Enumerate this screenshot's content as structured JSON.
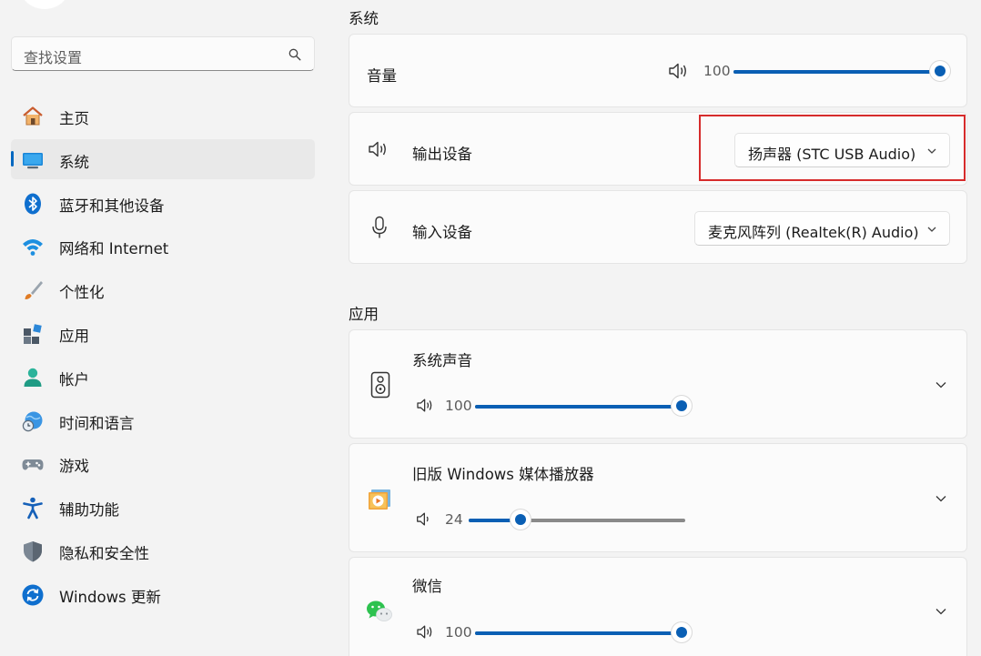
{
  "search": {
    "placeholder": "查找设置"
  },
  "nav": [
    {
      "name": "nav-item-home",
      "icon": "home-icon",
      "label": "主页",
      "active": false
    },
    {
      "name": "nav-item-system",
      "icon": "monitor-icon",
      "label": "系统",
      "active": true
    },
    {
      "name": "nav-item-bluetooth",
      "icon": "bluetooth-icon",
      "label": "蓝牙和其他设备",
      "active": false
    },
    {
      "name": "nav-item-network",
      "icon": "wifi-icon",
      "label": "网络和 Internet",
      "active": false
    },
    {
      "name": "nav-item-personalization",
      "icon": "brush-icon",
      "label": "个性化",
      "active": false
    },
    {
      "name": "nav-item-apps",
      "icon": "apps-icon",
      "label": "应用",
      "active": false
    },
    {
      "name": "nav-item-accounts",
      "icon": "person-icon",
      "label": "帐户",
      "active": false
    },
    {
      "name": "nav-item-time-language",
      "icon": "globe-clock-icon",
      "label": "时间和语言",
      "active": false
    },
    {
      "name": "nav-item-gaming",
      "icon": "gamepad-icon",
      "label": "游戏",
      "active": false
    },
    {
      "name": "nav-item-accessibility",
      "icon": "accessibility-icon",
      "label": "辅助功能",
      "active": false
    },
    {
      "name": "nav-item-privacy",
      "icon": "shield-icon",
      "label": "隐私和安全性",
      "active": false
    },
    {
      "name": "nav-item-windows-update",
      "icon": "update-icon",
      "label": "Windows 更新",
      "active": false
    }
  ],
  "system_section": {
    "title": "系统",
    "volume": {
      "label": "音量",
      "value": "100",
      "level": 1.0
    },
    "output": {
      "label": "输出设备",
      "selected": "扬声器 (STC USB Audio)"
    },
    "input": {
      "label": "输入设备",
      "selected": "麦克风阵列 (Realtek(R) Audio)"
    }
  },
  "apps_section": {
    "title": "应用",
    "items": [
      {
        "name": "系统声音",
        "volume": "100",
        "level": 1.0,
        "icon": "speaker-box-icon"
      },
      {
        "name": "旧版 Windows 媒体播放器",
        "volume": "24",
        "level": 0.24,
        "icon": "media-player-icon"
      },
      {
        "name": "微信",
        "volume": "100",
        "level": 1.0,
        "icon": "wechat-icon"
      }
    ]
  },
  "colors": {
    "accent": "#0a5fb4",
    "highlight_border": "#d62b2b",
    "background": "#f3f3f3",
    "card": "#fbfbfb"
  }
}
